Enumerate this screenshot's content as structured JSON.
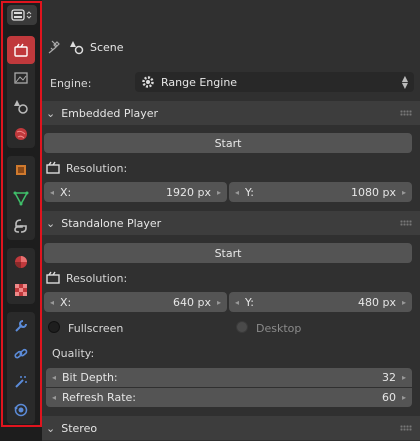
{
  "header": {
    "title": "Scene"
  },
  "engine": {
    "label": "Engine:",
    "value": "Range Engine"
  },
  "embedded": {
    "title": "Embedded Player",
    "start": "Start",
    "resolution_label": "Resolution:",
    "x_label": "X:",
    "x_value": "1920 px",
    "y_label": "Y:",
    "y_value": "1080 px"
  },
  "standalone": {
    "title": "Standalone Player",
    "start": "Start",
    "resolution_label": "Resolution:",
    "x_label": "X:",
    "x_value": "640 px",
    "y_label": "Y:",
    "y_value": "480 px",
    "fullscreen": "Fullscreen",
    "desktop": "Desktop",
    "quality_label": "Quality:",
    "bit_depth_label": "Bit Depth:",
    "bit_depth_value": "32",
    "refresh_rate_label": "Refresh Rate:",
    "refresh_rate_value": "60"
  },
  "stereo": {
    "title": "Stereo"
  }
}
